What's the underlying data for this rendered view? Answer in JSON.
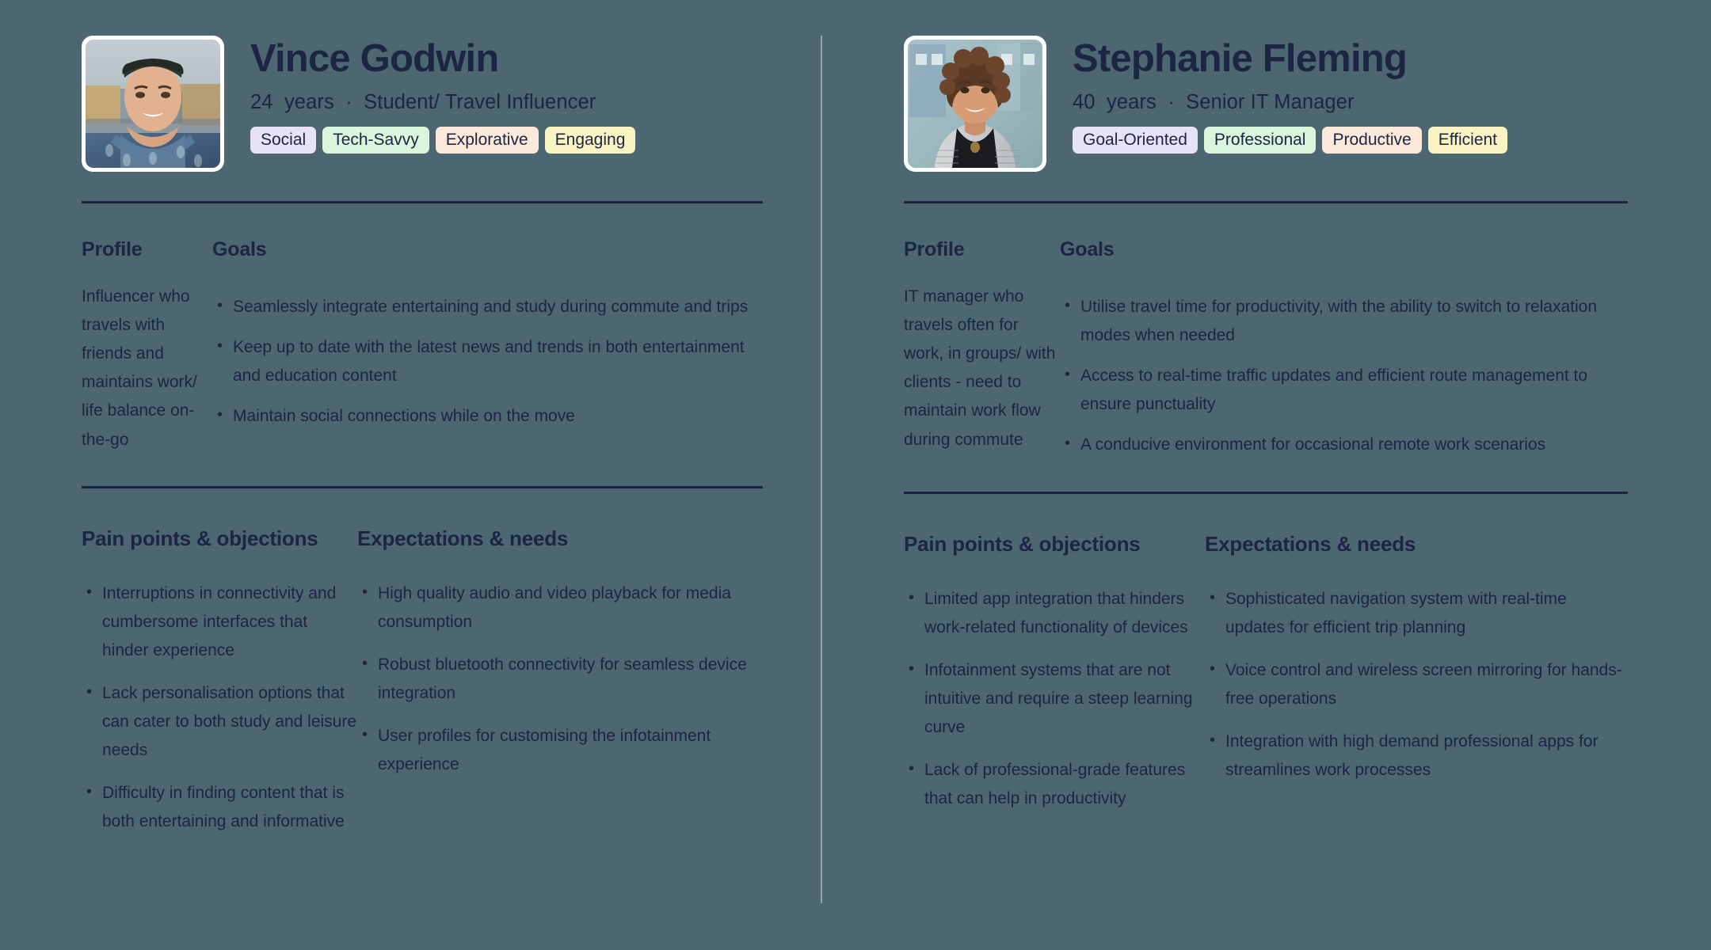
{
  "theme": {
    "background": "#4c6771",
    "ink": "#1c2541",
    "divider_vertical": "#8fa3ab",
    "divider_horizontal": "#1c2541",
    "avatar_frame": "#ffffff"
  },
  "section_titles": {
    "profile": "Profile",
    "goals": "Goals",
    "pain": "Pain points & objections",
    "expectations": "Expectations & needs"
  },
  "personas": [
    {
      "name": "Vince Godwin",
      "age": "24",
      "age_unit": "years",
      "separator": "·",
      "role": "Student/ Travel Influencer",
      "avatar_name": "avatar-vince-godwin",
      "tags": [
        {
          "label": "Social",
          "color": "#e7e2f8"
        },
        {
          "label": "Tech-Savvy",
          "color": "#d9f5dc"
        },
        {
          "label": "Explorative",
          "color": "#fde9d9"
        },
        {
          "label": "Engaging",
          "color": "#f9f4c2"
        }
      ],
      "profile": "Influencer who travels with friends and maintains work/ life balance on-the-go",
      "goals": [
        "Seamlessly integrate entertaining and study during commute and trips",
        "Keep up to date with the latest news and trends in both entertainment and education content",
        "Maintain social connections while on the move"
      ],
      "pain_points": [
        "Interruptions in connectivity and cumbersome interfaces that hinder experience",
        "Lack personalisation options that can cater to both study and leisure needs",
        "Difficulty in finding content that is both entertaining and informative"
      ],
      "expectations": [
        "High quality audio and video playback for media consumption",
        "Robust bluetooth connectivity for seamless device integration",
        "User profiles for customising the infotainment experience"
      ]
    },
    {
      "name": "Stephanie Fleming",
      "age": "40",
      "age_unit": "years",
      "separator": "·",
      "role": "Senior IT Manager",
      "avatar_name": "avatar-stephanie-fleming",
      "tags": [
        {
          "label": "Goal-Oriented",
          "color": "#e7e2f8"
        },
        {
          "label": "Professional",
          "color": "#d9f5dc"
        },
        {
          "label": "Productive",
          "color": "#fde9d9"
        },
        {
          "label": "Efficient",
          "color": "#f9f4c2"
        }
      ],
      "profile": "IT manager who travels often for work, in groups/ with clients - need to maintain work flow during commute",
      "goals": [
        "Utilise travel time for productivity, with the ability to switch to relaxation modes when needed",
        "Access to real-time traffic updates and efficient route management to ensure punctuality",
        "A conducive environment for occasional remote work scenarios"
      ],
      "pain_points": [
        "Limited app integration that hinders work-related functionality of devices",
        "Infotainment systems that are not intuitive and require a steep learning curve",
        "Lack of professional-grade features that can help in productivity"
      ],
      "expectations": [
        "Sophisticated navigation system with real-time updates for efficient trip planning",
        "Voice control and wireless screen mirroring for hands-free operations",
        "Integration with high demand professional apps for streamlines work processes"
      ]
    }
  ]
}
